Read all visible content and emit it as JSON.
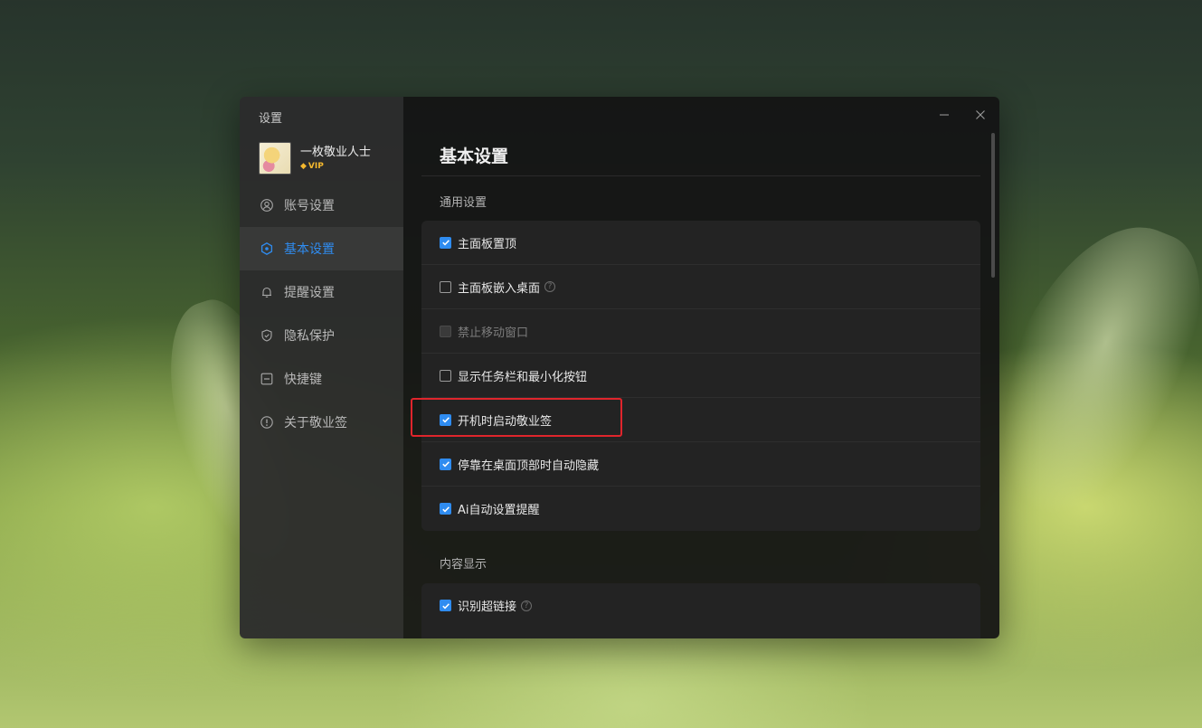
{
  "window": {
    "title": "设置"
  },
  "profile": {
    "username": "一枚敬业人士",
    "badge": "VIP"
  },
  "nav": {
    "items": [
      {
        "label": "账号设置",
        "icon": "user-icon",
        "active": false
      },
      {
        "label": "基本设置",
        "icon": "settings-icon",
        "active": true
      },
      {
        "label": "提醒设置",
        "icon": "bell-icon",
        "active": false
      },
      {
        "label": "隐私保护",
        "icon": "shield-icon",
        "active": false
      },
      {
        "label": "快捷键",
        "icon": "keyboard-icon",
        "active": false
      },
      {
        "label": "关于敬业签",
        "icon": "info-icon",
        "active": false
      }
    ]
  },
  "main": {
    "title": "基本设置",
    "general": {
      "label": "通用设置",
      "options": [
        {
          "label": "主面板置顶",
          "checked": true,
          "disabled": false
        },
        {
          "label": "主面板嵌入桌面",
          "checked": false,
          "disabled": false,
          "help": "?"
        },
        {
          "label": "禁止移动窗口",
          "checked": false,
          "disabled": true
        },
        {
          "label": "显示任务栏和最小化按钮",
          "checked": false,
          "disabled": false
        },
        {
          "label": "开机时启动敬业签",
          "checked": true,
          "disabled": false,
          "highlighted": true
        },
        {
          "label": "停靠在桌面顶部时自动隐藏",
          "checked": true,
          "disabled": false
        },
        {
          "label": "Ai自动设置提醒",
          "checked": true,
          "disabled": false
        }
      ]
    },
    "content": {
      "label": "内容显示",
      "options": [
        {
          "label": "识别超链接",
          "checked": true,
          "disabled": false,
          "help": "?"
        }
      ]
    }
  },
  "colors": {
    "accent": "#2f8cf0",
    "vip": "#f5b82e",
    "highlight": "#e0252c"
  }
}
